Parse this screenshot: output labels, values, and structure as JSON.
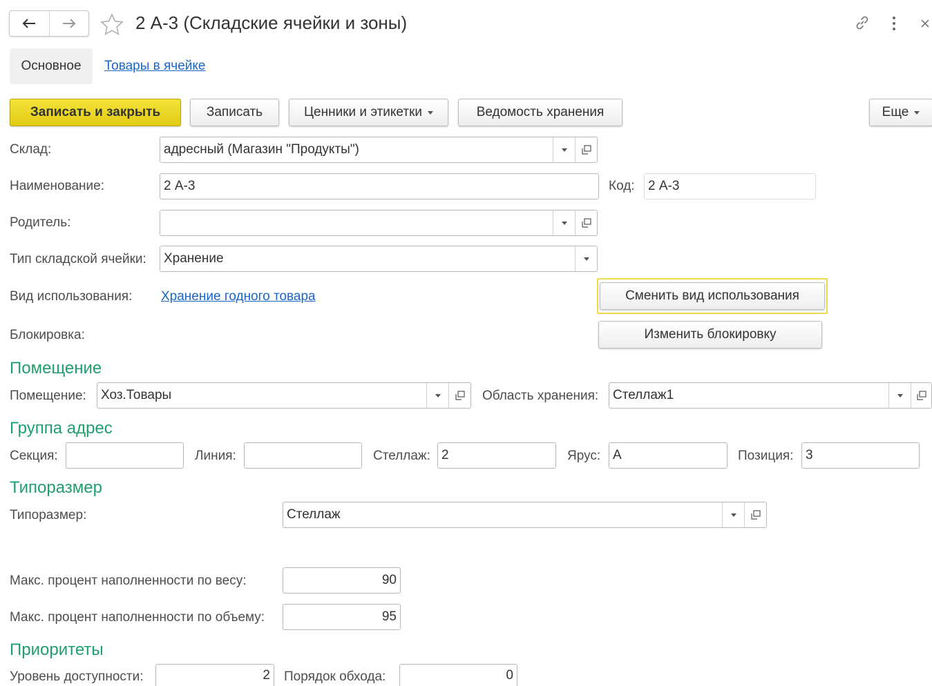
{
  "window": {
    "title": "2 А-3 (Складские ячейки и зоны)"
  },
  "tabs": {
    "main": "Основное",
    "goods": "Товары в ячейке"
  },
  "toolbar": {
    "save_close": "Записать и закрыть",
    "save": "Записать",
    "price_tags": "Ценники и этикетки",
    "storage_report": "Ведомость хранения",
    "more": "Еще"
  },
  "form": {
    "warehouse_label": "Склад:",
    "warehouse_value": "адресный (Магазин \"Продукты\")",
    "name_label": "Наименование:",
    "name_value": "2 А-3",
    "code_label": "Код:",
    "code_value": "2 А-3",
    "parent_label": "Родитель:",
    "parent_value": "",
    "cell_type_label": "Тип складской ячейки:",
    "cell_type_value": "Хранение",
    "usage_label": "Вид использования:",
    "usage_value": "Хранение годного товара",
    "change_usage_button": "Сменить вид использования",
    "block_label": "Блокировка:",
    "change_block_button": "Изменить блокировку"
  },
  "room": {
    "header": "Помещение",
    "room_label": "Помещение:",
    "room_value": "Хоз.Товары",
    "area_label": "Область хранения:",
    "area_value": "Стеллаж1"
  },
  "address": {
    "header": "Группа адрес",
    "section_label": "Секция:",
    "section_value": "",
    "line_label": "Линия:",
    "line_value": "",
    "rack_label": "Стеллаж:",
    "rack_value": "2",
    "tier_label": "Ярус:",
    "tier_value": "А",
    "position_label": "Позиция:",
    "position_value": "3"
  },
  "size": {
    "header": "Типоразмер",
    "size_label": "Типоразмер:",
    "size_value": "Стеллаж",
    "max_weight_label": "Макс. процент наполненности по весу:",
    "max_weight_value": "90",
    "max_volume_label": "Макс. процент наполненности по объему:",
    "max_volume_value": "95"
  },
  "priorities": {
    "header": "Приоритеты",
    "access_label": "Уровень доступности:",
    "access_value": "2",
    "order_label": "Порядок обхода:",
    "order_value": "0"
  }
}
